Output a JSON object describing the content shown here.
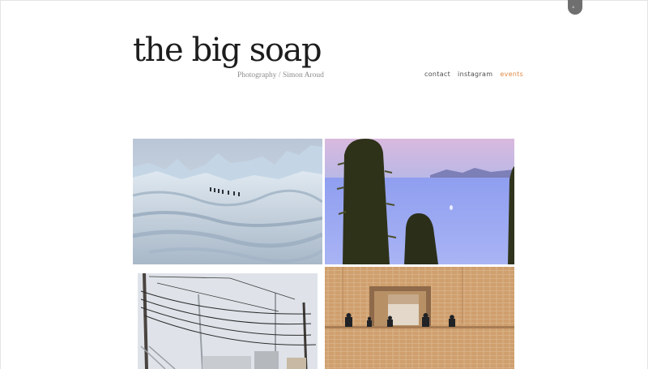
{
  "site": {
    "title": "the big soap",
    "tagline": "Photography / Simon Aroud"
  },
  "nav": {
    "items": [
      {
        "label": "contact",
        "active": false
      },
      {
        "label": "instagram",
        "active": false
      },
      {
        "label": "events",
        "active": true
      }
    ],
    "active_color": "#e08a45"
  },
  "gallery": {
    "photos": [
      {
        "subject": "glacier-mountains"
      },
      {
        "subject": "cactus-lake-dusk"
      },
      {
        "subject": "power-poles-street"
      },
      {
        "subject": "brick-building-balcony"
      }
    ]
  },
  "colors": {
    "text": "#1d1d1d",
    "tagline": "#8c8c8c",
    "nav": "#4b4b4b",
    "tab": "#6f6f6f"
  },
  "icons": {
    "top_tab": "pull-tab-icon"
  }
}
